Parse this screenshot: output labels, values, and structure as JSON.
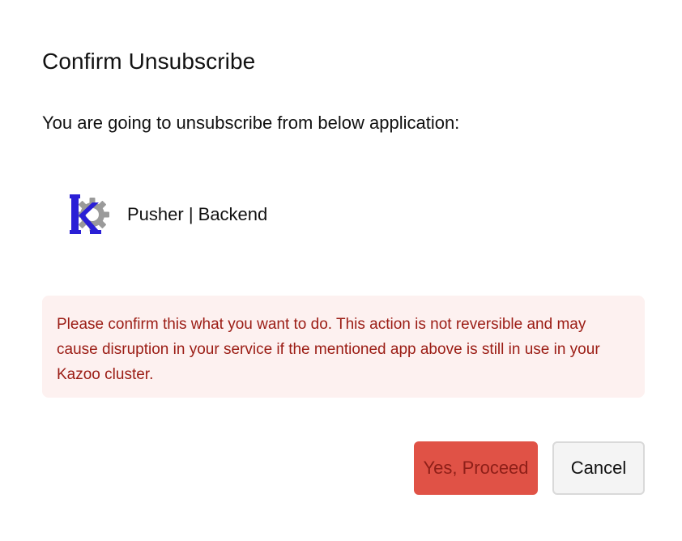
{
  "dialog": {
    "title": "Confirm Unsubscribe",
    "intro": "You are going to unsubscribe from below application:",
    "app": {
      "name": "Pusher | Backend",
      "logo_icon": "kazoo-app-gear-logo",
      "logo_letter": "k"
    },
    "warning": {
      "text": "Please confirm this what you want to do. This action is not reversible and may cause disruption in your service if the mentioned app above is still in use in your Kazoo cluster."
    },
    "buttons": {
      "proceed_label": "Yes, Proceed",
      "cancel_label": "Cancel"
    }
  },
  "colors": {
    "warning_bg": "#fdf1f0",
    "warning_text": "#9b1c14",
    "proceed_bg": "#e05246",
    "proceed_text": "#8e1f18",
    "logo_letter": "#2a1fd6",
    "logo_gear": "#9a9a9a"
  }
}
